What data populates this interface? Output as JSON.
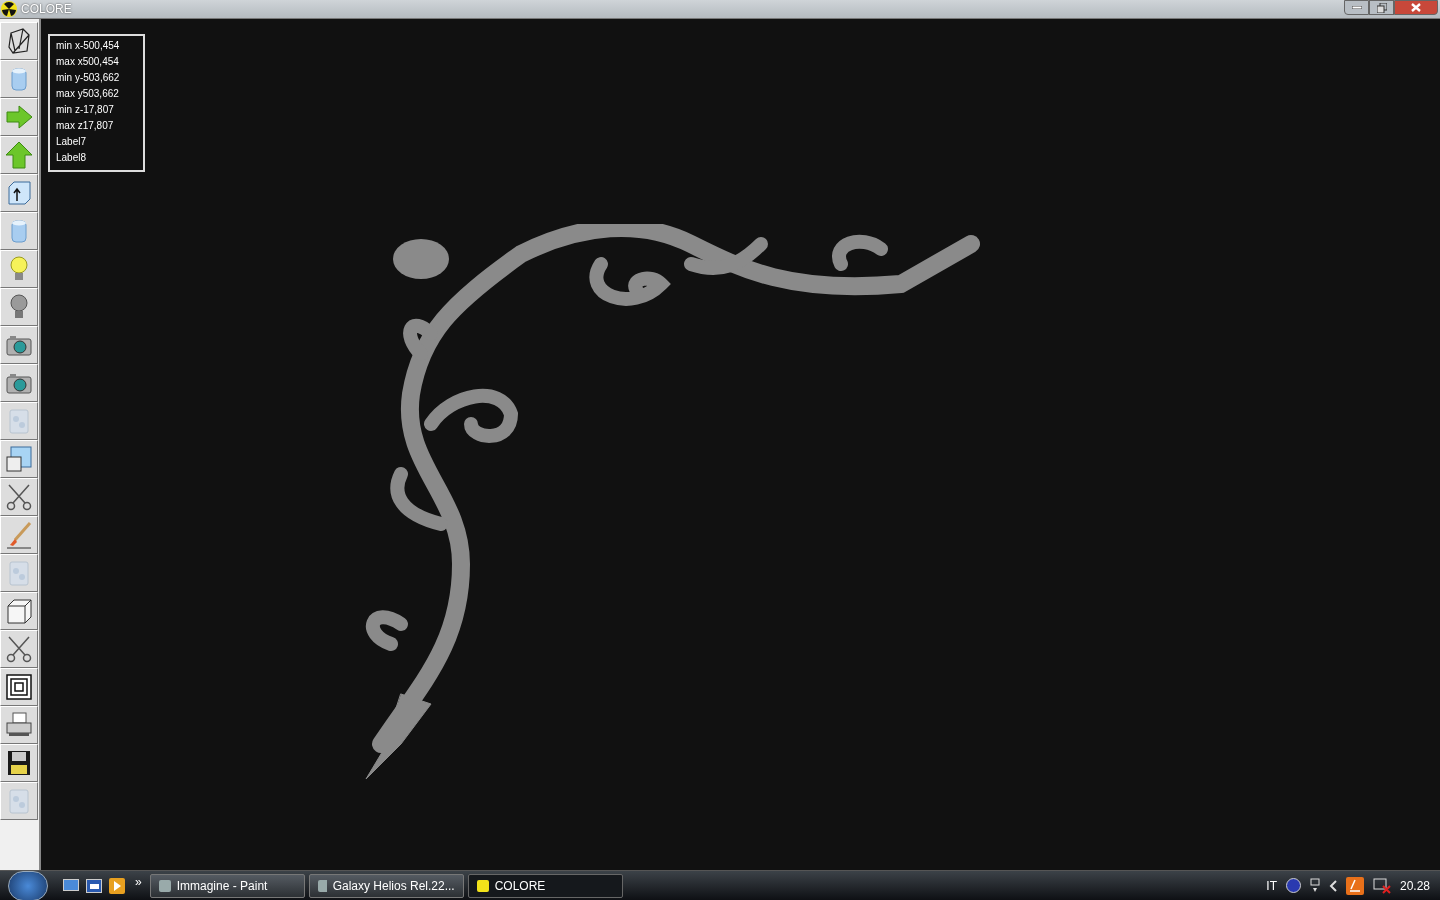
{
  "window": {
    "title": "COLORE"
  },
  "info_panel": {
    "lines": [
      "min x-500,454",
      "max x500,454",
      "min y-503,662",
      "max y503,662",
      "min z-17,807",
      "max z17,807",
      "Label7",
      "Label8"
    ]
  },
  "taskbar": {
    "buttons": [
      {
        "label": "Immagine - Paint",
        "selected": false
      },
      {
        "label": "Galaxy Helios  Rel.22...",
        "selected": false
      },
      {
        "label": "COLORE",
        "selected": true
      }
    ],
    "language": "IT",
    "clock": "20.28",
    "more": "»"
  }
}
